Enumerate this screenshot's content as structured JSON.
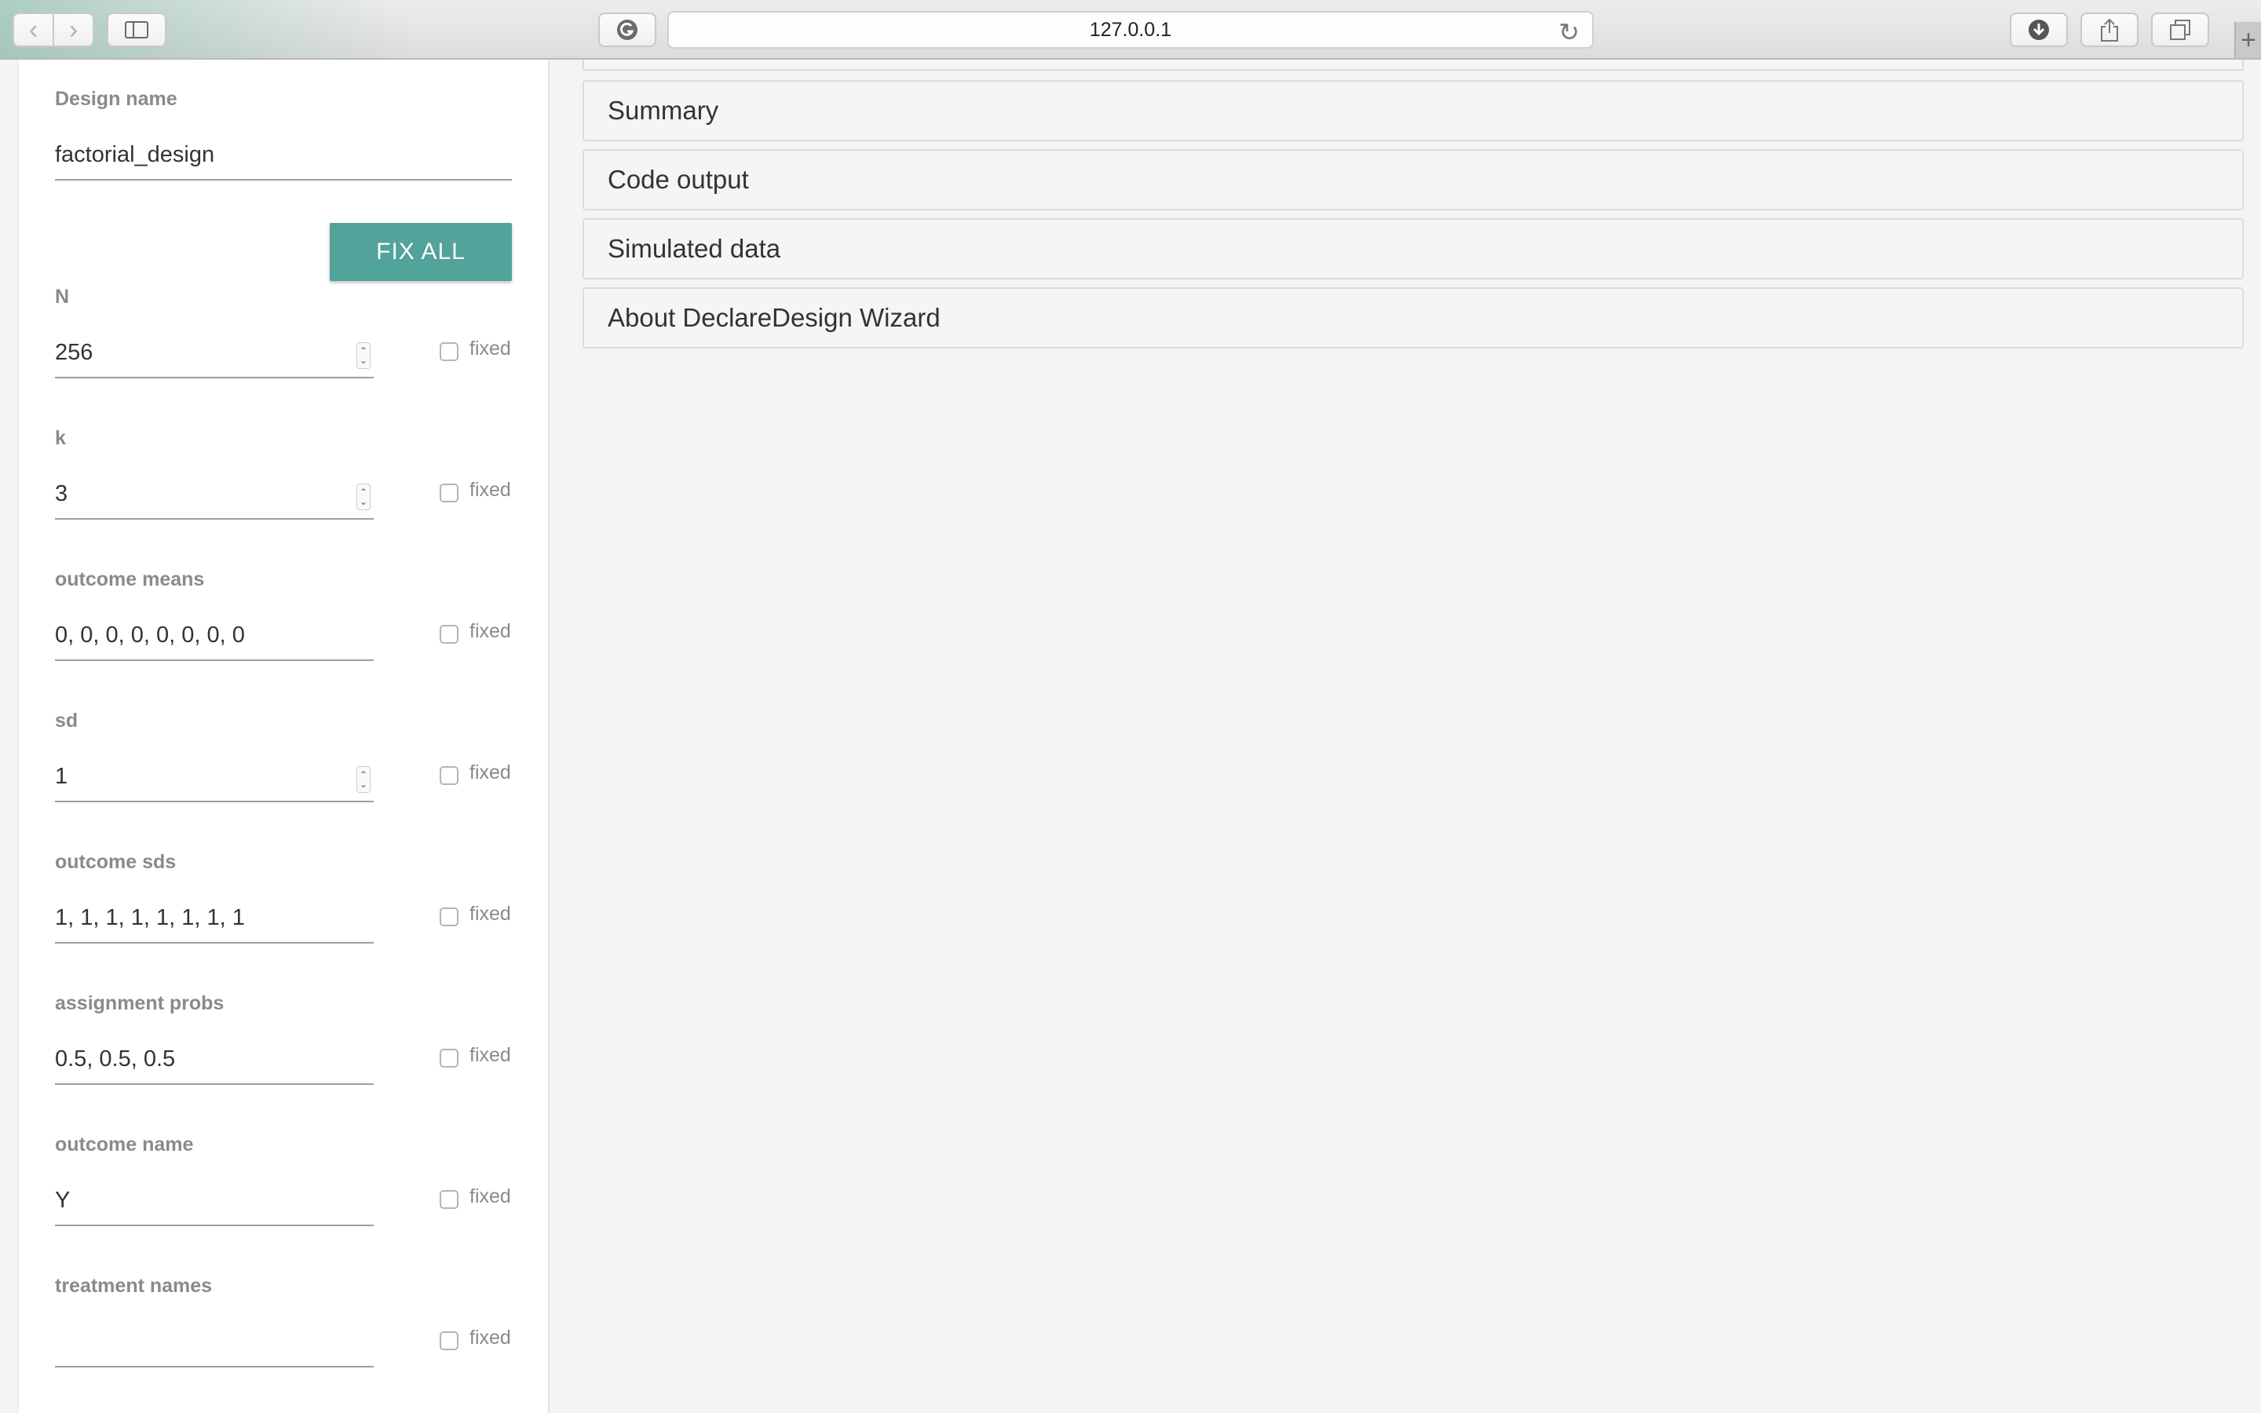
{
  "browser": {
    "back_icon": "‹",
    "forward_icon": "›",
    "sidebar_icon": "▭",
    "refresh_icon": "G",
    "url": "127.0.0.1",
    "reload_icon": "↻",
    "download_icon": "⬇",
    "share_icon": "⇧",
    "tabs_icon": "⧉",
    "new_tab_icon": "+"
  },
  "sidebar": {
    "design_name_label": "Design name",
    "design_name_value": "factorial_design",
    "fix_all_label": "FIX ALL",
    "fixed_label": "fixed",
    "params": [
      {
        "label": "N",
        "value": "256",
        "spinner": true
      },
      {
        "label": "k",
        "value": "3",
        "spinner": true
      },
      {
        "label": "outcome means",
        "value": "0, 0, 0, 0, 0, 0, 0, 0",
        "spinner": false
      },
      {
        "label": "sd",
        "value": "1",
        "spinner": true
      },
      {
        "label": "outcome sds",
        "value": "1, 1, 1, 1, 1, 1, 1, 1",
        "spinner": false
      },
      {
        "label": "assignment probs",
        "value": "0.5, 0.5, 0.5",
        "spinner": false
      },
      {
        "label": "outcome name",
        "value": "Y",
        "spinner": false
      },
      {
        "label": "treatment names",
        "value": "",
        "spinner": false
      }
    ]
  },
  "main": {
    "panels": [
      "Summary",
      "Code output",
      "Simulated data",
      "About DeclareDesign Wizard"
    ]
  },
  "colors": {
    "accent": "#52a39a",
    "background": "#f4f4f4"
  }
}
